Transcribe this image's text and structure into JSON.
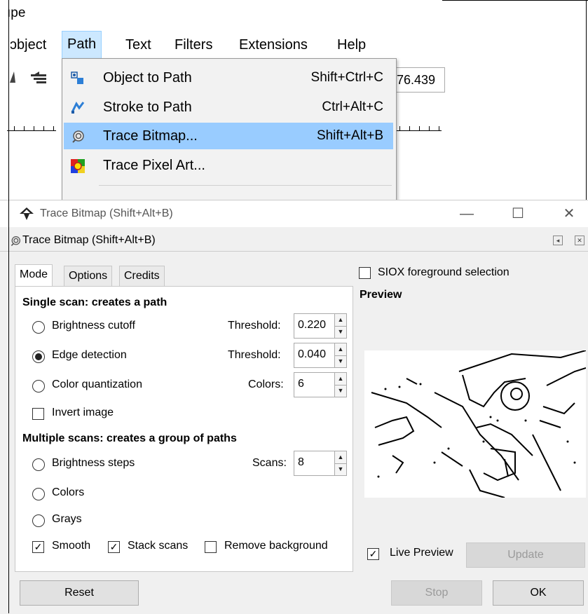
{
  "app": {
    "title_fragment": "ıpe",
    "coord_value": "76.439"
  },
  "menubar": {
    "items": [
      {
        "label": "Object",
        "visible": "ɔbject"
      },
      {
        "label": "Path"
      },
      {
        "label": "Text"
      },
      {
        "label": "Filters"
      },
      {
        "label": "Extensions"
      },
      {
        "label": "Help"
      }
    ]
  },
  "path_menu": {
    "items": [
      {
        "label": "Object to Path",
        "shortcut": "Shift+Ctrl+C",
        "icon": "object-to-path-icon"
      },
      {
        "label": "Stroke to Path",
        "shortcut": "Ctrl+Alt+C",
        "icon": "stroke-to-path-icon"
      },
      {
        "label": "Trace Bitmap...",
        "shortcut": "Shift+Alt+B",
        "icon": "trace-bitmap-icon",
        "highlighted": true
      },
      {
        "label": "Trace Pixel Art...",
        "shortcut": "",
        "icon": "trace-pixel-art-icon"
      }
    ]
  },
  "dialog": {
    "window_title": "Trace Bitmap (Shift+Alt+B)",
    "panel_title": "Trace Bitmap (Shift+Alt+B)",
    "win_min": "—",
    "win_max": "☐",
    "win_close": "✕",
    "tabs": [
      "Mode",
      "Options",
      "Credits"
    ],
    "single_scan_heading": "Single scan: creates a path",
    "brightness_cutoff": "Brightness cutoff",
    "edge_detection": "Edge detection",
    "color_quantization": "Color quantization",
    "invert_image": "Invert image",
    "threshold_label": "Threshold:",
    "colors_label": "Colors:",
    "brightness_threshold": "0.220",
    "edge_threshold": "0.040",
    "colors_value": "6",
    "multi_scan_heading": "Multiple scans: creates a group of paths",
    "brightness_steps": "Brightness steps",
    "scans_label": "Scans:",
    "scans_value": "8",
    "colors_option": "Colors",
    "grays_option": "Grays",
    "smooth": "Smooth",
    "stack_scans": "Stack scans",
    "remove_background": "Remove background",
    "siox": "SIOX foreground selection",
    "preview_label": "Preview",
    "live_preview": "Live Preview",
    "update": "Update",
    "reset": "Reset",
    "stop": "Stop",
    "ok": "OK",
    "selected_mode": "edge_detection",
    "smooth_checked": true,
    "stack_scans_checked": true,
    "remove_background_checked": false,
    "live_preview_checked": true
  }
}
